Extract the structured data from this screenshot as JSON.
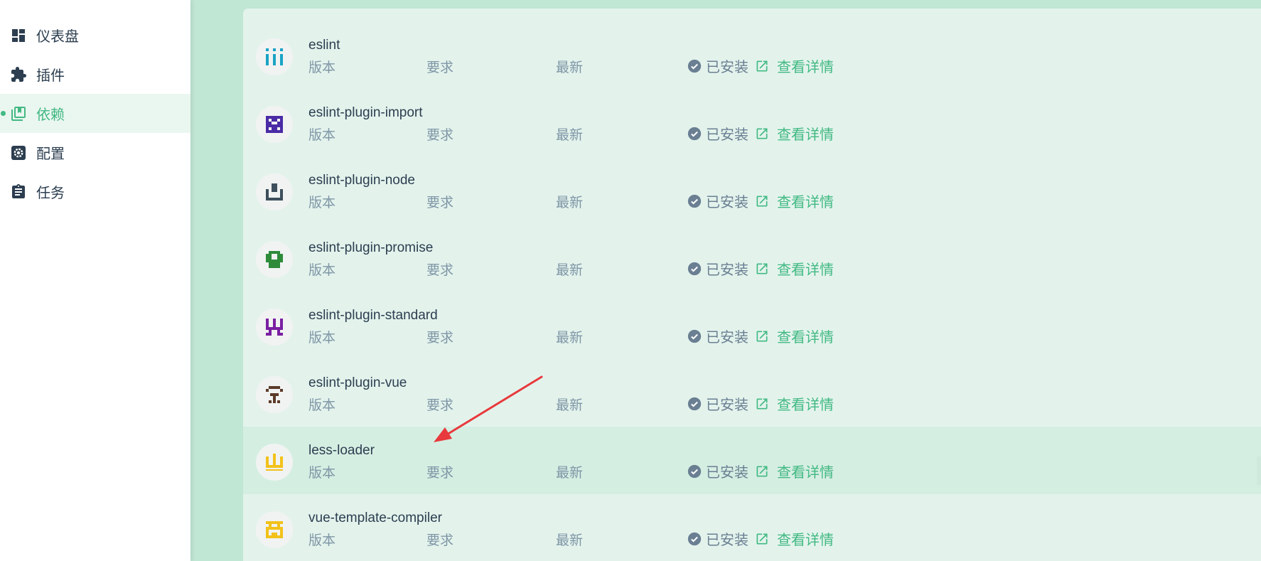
{
  "sidebar": {
    "items": [
      {
        "label": "仪表盘",
        "icon": "dashboard-icon"
      },
      {
        "label": "插件",
        "icon": "puzzle-icon"
      },
      {
        "label": "依赖",
        "icon": "library-icon",
        "active": true
      },
      {
        "label": "配置",
        "icon": "gear-icon"
      },
      {
        "label": "任务",
        "icon": "clipboard-icon"
      }
    ]
  },
  "dependencies": [
    {
      "name": "eslint",
      "version_label": "版本",
      "required_label": "要求",
      "latest_label": "最新",
      "status": "已安装",
      "details": "查看详情",
      "avatar_color": "#1aa3c4"
    },
    {
      "name": "eslint-plugin-import",
      "version_label": "版本",
      "required_label": "要求",
      "latest_label": "最新",
      "status": "已安装",
      "details": "查看详情",
      "avatar_color": "#4b2aa6"
    },
    {
      "name": "eslint-plugin-node",
      "version_label": "版本",
      "required_label": "要求",
      "latest_label": "最新",
      "status": "已安装",
      "details": "查看详情",
      "avatar_color": "#3d4f5c"
    },
    {
      "name": "eslint-plugin-promise",
      "version_label": "版本",
      "required_label": "要求",
      "latest_label": "最新",
      "status": "已安装",
      "details": "查看详情",
      "avatar_color": "#2e8b3a"
    },
    {
      "name": "eslint-plugin-standard",
      "version_label": "版本",
      "required_label": "要求",
      "latest_label": "最新",
      "status": "已安装",
      "details": "查看详情",
      "avatar_color": "#7a1fa2"
    },
    {
      "name": "eslint-plugin-vue",
      "version_label": "版本",
      "required_label": "要求",
      "latest_label": "最新",
      "status": "已安装",
      "details": "查看详情",
      "avatar_color": "#5b3a29"
    },
    {
      "name": "less-loader",
      "version_label": "版本",
      "required_label": "要求",
      "latest_label": "最新",
      "status": "已安装",
      "details": "查看详情",
      "avatar_color": "#f2c21b"
    },
    {
      "name": "vue-template-compiler",
      "version_label": "版本",
      "required_label": "要求",
      "latest_label": "最新",
      "status": "已安装",
      "details": "查看详情",
      "avatar_color": "#f2c21b"
    }
  ],
  "colors": {
    "accent": "#42b983",
    "text": "#2c3e50",
    "muted": "#7f96a6",
    "main_bg": "#c0e6d4",
    "panel_bg": "#e3f3ec",
    "annotation_arrow": "#e8393c"
  }
}
